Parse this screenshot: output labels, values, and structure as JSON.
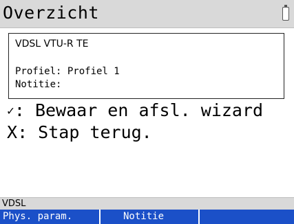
{
  "header": {
    "title": "Overzicht",
    "battery_icon": "battery-icon"
  },
  "info": {
    "line1": "VDSL VTU-R TE",
    "profile": "Profiel: Profiel 1",
    "note": "Notitie:"
  },
  "options": [
    {
      "key": "✓",
      "label": ": Bewaar en afsl. wizard"
    },
    {
      "key": "X",
      "label": ": Stap terug."
    }
  ],
  "status": {
    "text": "VDSL"
  },
  "softkeys": [
    {
      "label": "Phys. param."
    },
    {
      "label": "Notitie"
    }
  ],
  "colors": {
    "softkey_bg": "#1b50c8",
    "bar_bg": "#d9d9d9"
  }
}
